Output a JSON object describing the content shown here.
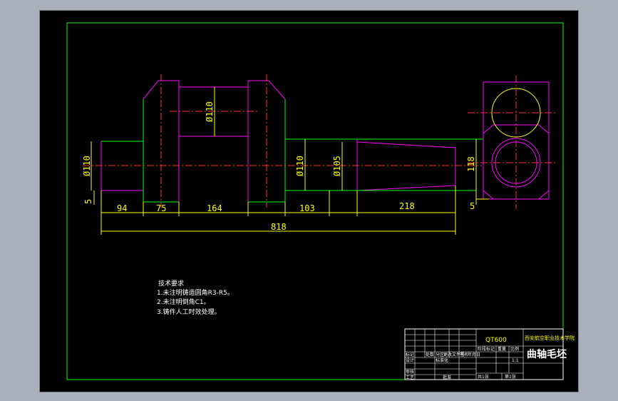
{
  "drawing": {
    "dimensions": {
      "dia_left": "Ø110",
      "dia_web": "Ø110",
      "dia_shaft": "Ø110",
      "dia_taper": "Ø105",
      "end_height": "118",
      "offset_left": "5",
      "offset_right": "5",
      "len_94": "94",
      "len_75": "75",
      "len_164": "164",
      "len_103": "103",
      "len_218": "218",
      "len_total": "818"
    },
    "notes": {
      "title": "技术要求",
      "items": [
        "1.未注明铸造圆角R3-R5。",
        "2.未注明倒角C1。",
        "3.铸件人工时效处理。"
      ]
    },
    "title_block": {
      "material": "QT600",
      "school": "西安航空职业技术学院",
      "part_name": "曲轴毛坯",
      "scale_value": "1:1",
      "row_labels": [
        "标记",
        "处数",
        "分区",
        "更改文件号",
        "签名",
        "年月日"
      ],
      "stage_labels": [
        "阶段标记",
        "重量",
        "比例"
      ],
      "design_label": "设计",
      "standard_label": "标准化",
      "check_label": "审核",
      "process_label": "工艺",
      "approve_label": "批准",
      "sheet_total": "共1张",
      "sheet_index": "第1张"
    },
    "colors": {
      "outline": "#ff00ff",
      "frame": "#00ff00",
      "centerline": "#ff3030",
      "dimension": "#ffff00",
      "text": "#ffffff"
    }
  }
}
